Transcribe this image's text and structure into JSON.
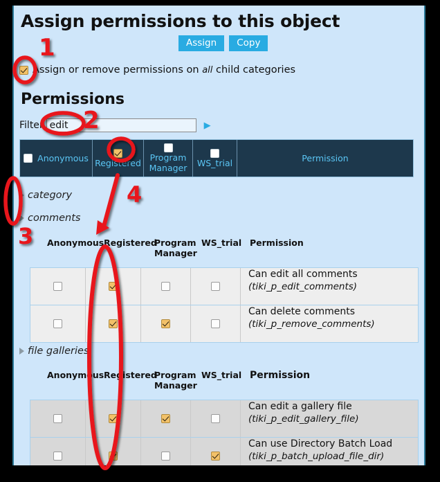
{
  "page": {
    "title": "Assign permissions to this object",
    "section_title": "Permissions"
  },
  "toolbar": {
    "assign_label": "Assign",
    "copy_label": "Copy",
    "button_color": "#29abe2"
  },
  "child_categories": {
    "checked": true,
    "text_before": "Assign or remove permissions on ",
    "emphasis": "all",
    "text_after": " child categories"
  },
  "filter": {
    "label": "Filter",
    "value": "edit",
    "placeholder": "",
    "go_icon": "play-triangle-icon"
  },
  "group_header": {
    "background": "#1d384c",
    "text_color": "#5bc6f5",
    "columns": [
      {
        "label": "Anonymous",
        "checked": false,
        "layout": "inline"
      },
      {
        "label": "Registered",
        "checked": true,
        "layout": "stacked-above"
      },
      {
        "label": "Program Manager",
        "checked": false,
        "layout": "stacked-above"
      },
      {
        "label": "WS_trial",
        "checked": false,
        "layout": "stacked-above"
      },
      {
        "label": "Permission",
        "checked": null,
        "layout": "text-only"
      }
    ]
  },
  "tree": {
    "category": {
      "label": "category",
      "expander": "triangle-right-icon"
    },
    "comments": {
      "label": "comments",
      "expander": "triangle-right-icon"
    },
    "file_galleries": {
      "label": "file galleries",
      "expander": "triangle-right-icon"
    }
  },
  "sub_headers": {
    "comments": [
      "Anonymous",
      "Registered",
      "Program Manager",
      "WS_trial",
      "Permission"
    ],
    "file_galleries": [
      "Anonymous",
      "Registered",
      "Program Manager",
      "WS_trial",
      "Permission"
    ]
  },
  "tables": {
    "comments": {
      "row_background": "#eeeeee",
      "rows": [
        {
          "anonymous": false,
          "registered": true,
          "program_manager": false,
          "ws_trial": false,
          "permission_title": "Can edit all comments",
          "permission_code": "(tiki_p_edit_comments)"
        },
        {
          "anonymous": false,
          "registered": true,
          "program_manager": true,
          "ws_trial": false,
          "permission_title": "Can delete comments",
          "permission_code": "(tiki_p_remove_comments)"
        }
      ]
    },
    "file_galleries": {
      "row_background": "#d8d8d8",
      "rows": [
        {
          "anonymous": false,
          "registered": true,
          "program_manager": true,
          "ws_trial": false,
          "permission_title": "Can edit a gallery file",
          "permission_code": "(tiki_p_edit_gallery_file)"
        },
        {
          "anonymous": false,
          "registered": true,
          "program_manager": false,
          "ws_trial": true,
          "permission_title": "Can use Directory Batch Load",
          "permission_code": "(tiki_p_batch_upload_file_dir)"
        }
      ]
    }
  },
  "annotations": {
    "color": "#e8131b",
    "markers": [
      {
        "number": "1",
        "shape": "ellipse",
        "target": "child-categories-checkbox"
      },
      {
        "number": "2",
        "shape": "ellipse",
        "target": "filter-input-value"
      },
      {
        "number": "3",
        "shape": "ellipse",
        "target": "tree-expander-column"
      },
      {
        "number": "4",
        "shape": "arrow",
        "target": "registered-column"
      }
    ]
  }
}
